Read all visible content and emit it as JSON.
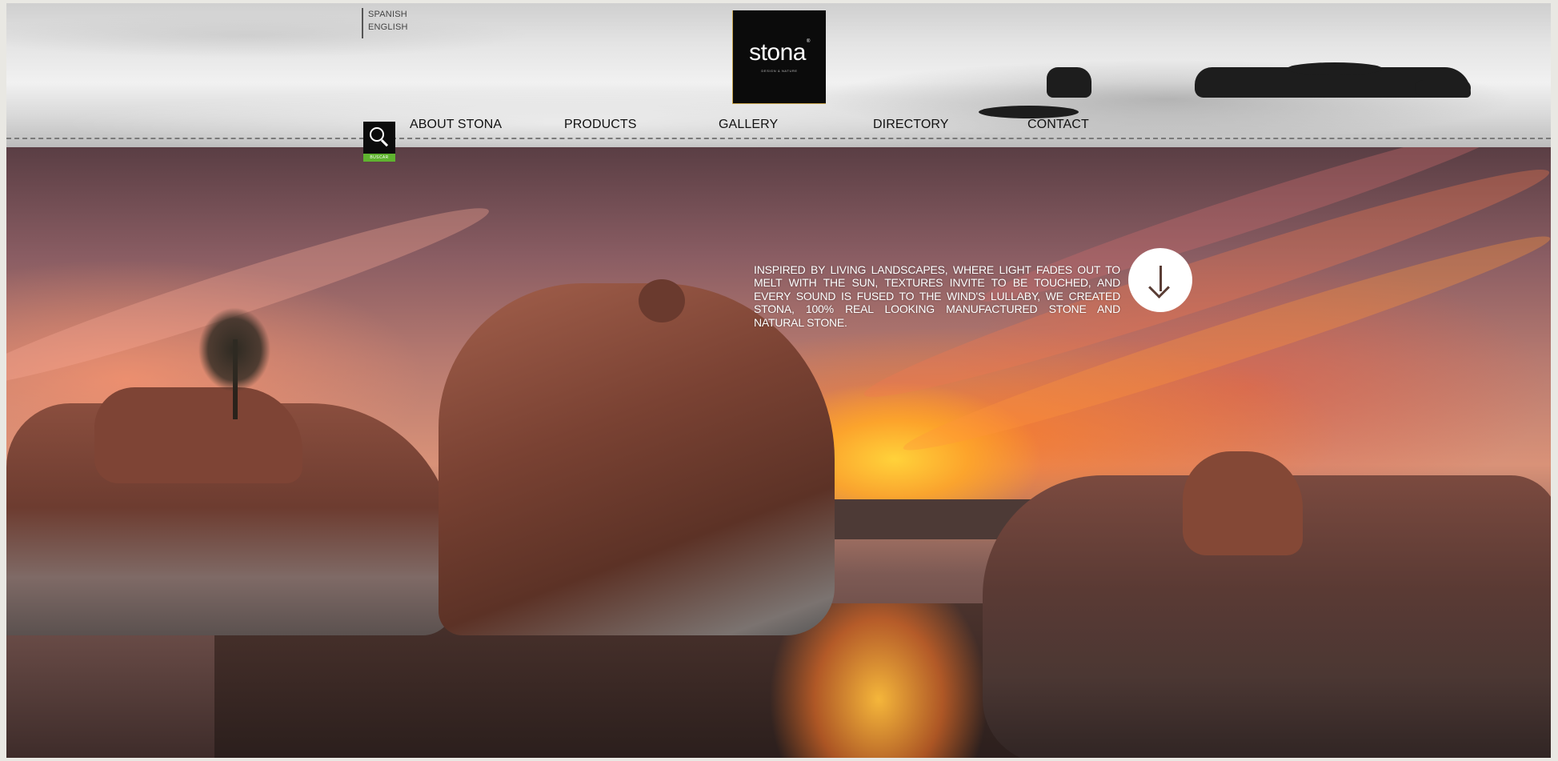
{
  "language_switcher": [
    "SPANISH",
    "ENGLISH"
  ],
  "logo": {
    "word": "stona",
    "tagline": "DESIGN & NATURE"
  },
  "nav": [
    {
      "label": "ABOUT STONA"
    },
    {
      "label": "PRODUCTS"
    },
    {
      "label": "GALLERY"
    },
    {
      "label": "DIRECTORY"
    },
    {
      "label": "CONTACT"
    }
  ],
  "search": {
    "label": "BUSCAR",
    "icon": "search-icon",
    "label_color": "#5fb32f"
  },
  "hero": {
    "intro": "INSPIRED BY LIVING LANDSCAPES, WHERE LIGHT FADES OUT TO MELT WITH THE SUN, TEXTURES INVITE TO BE TOUCHED, AND EVERY SOUND IS FUSED TO THE WIND'S LULLABY, WE CREATED STONA, 100% REAL LOOKING MANUFACTURED STONE AND NATURAL STONE.",
    "scroll_icon": "arrow-down-icon"
  },
  "colors": {
    "logo_bg": "#0b0b0b",
    "logo_accent": "#c9a54b",
    "nav_text": "#111111"
  }
}
